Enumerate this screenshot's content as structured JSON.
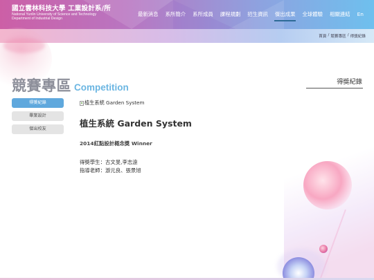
{
  "header": {
    "logo_zh": "國立雲林科技大學 工業設計系/所",
    "logo_en_line1": "National Yunlin University of Science and Technology",
    "logo_en_line2": "Department of Industrial Design",
    "nav": [
      {
        "label": "最新消息",
        "active": false
      },
      {
        "label": "系所簡介",
        "active": false
      },
      {
        "label": "系所成員",
        "active": false
      },
      {
        "label": "課程規劃",
        "active": false
      },
      {
        "label": "招生資訊",
        "active": false
      },
      {
        "label": "傑出成果",
        "active": true
      },
      {
        "label": "全球體驗",
        "active": false
      },
      {
        "label": "相關連結",
        "active": false
      },
      {
        "label": "En",
        "active": false
      }
    ]
  },
  "breadcrumb": {
    "home": "首頁",
    "sep": "/",
    "section": "競賽專區",
    "current": "得獎紀錄"
  },
  "page": {
    "title_zh": "競賽專區",
    "title_en": "Competition",
    "right_heading": "得獎紀錄"
  },
  "sidebar": {
    "items": [
      {
        "label": "得獎紀錄",
        "active": true
      },
      {
        "label": "畢業設計",
        "active": false
      },
      {
        "label": "傑出校友",
        "active": false
      }
    ]
  },
  "content": {
    "image_alt": "植生系統 Garden System",
    "work_title": "植生系統 Garden System",
    "award": "2014紅點設計概念獎 Winner",
    "students": "得獎學生：古文旻,李志遠",
    "advisors": "指導老師：游元良、張景旭"
  },
  "colors": {
    "active_blue": "#5fa8dd",
    "title_gray": "#8d8f9a",
    "title_blue": "#6bb6e2",
    "nav_active_underline": "#2d6a96"
  }
}
